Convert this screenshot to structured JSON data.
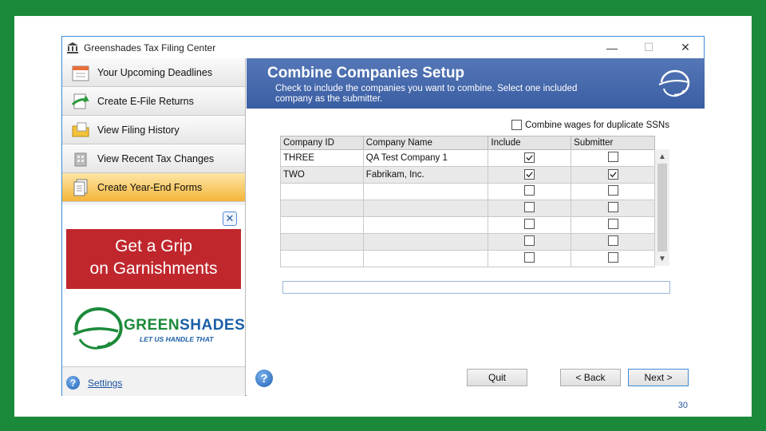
{
  "window": {
    "title": "Greenshades Tax Filing Center",
    "controls": {
      "minimize": "—",
      "maximize": "☐",
      "close": "✕"
    }
  },
  "nav": {
    "items": [
      {
        "label": "Your Upcoming Deadlines",
        "icon": "calendar-icon",
        "active": false
      },
      {
        "label": "Create E-File Returns",
        "icon": "efile-icon",
        "active": false
      },
      {
        "label": "View Filing History",
        "icon": "folder-icon",
        "active": false
      },
      {
        "label": "View Recent Tax Changes",
        "icon": "building-icon",
        "active": false
      },
      {
        "label": "Create Year-End Forms",
        "icon": "forms-icon",
        "active": true
      }
    ]
  },
  "ad": {
    "close_icon": "close-icon",
    "banner_line1": "Get a Grip",
    "banner_line2": "on Garnishments",
    "brand_part1": "GREEN",
    "brand_part2": "SHADES",
    "tagline": "LET US HANDLE THAT"
  },
  "settings": {
    "label": "Settings"
  },
  "header": {
    "title": "Combine Companies Setup",
    "subtitle": "Check to include the companies you want to combine.  Select one included company as the submitter."
  },
  "combine_wages": {
    "label": "Combine wages for duplicate SSNs",
    "checked": false
  },
  "grid": {
    "columns": [
      "Company ID",
      "Company Name",
      "Include",
      "Submitter"
    ],
    "rows": [
      {
        "company_id": "THREE",
        "company_name": "QA Test Company 1",
        "include": true,
        "submitter": false
      },
      {
        "company_id": "TWO",
        "company_name": "Fabrikam, Inc.",
        "include": true,
        "submitter": true
      },
      {
        "company_id": "",
        "company_name": "",
        "include": false,
        "submitter": false
      },
      {
        "company_id": "",
        "company_name": "",
        "include": false,
        "submitter": false
      },
      {
        "company_id": "",
        "company_name": "",
        "include": false,
        "submitter": false
      },
      {
        "company_id": "",
        "company_name": "",
        "include": false,
        "submitter": false
      },
      {
        "company_id": "",
        "company_name": "",
        "include": false,
        "submitter": false
      }
    ]
  },
  "buttons": {
    "quit": "Quit",
    "back": "< Back",
    "next": "Next >"
  },
  "slide_number": "30",
  "colors": {
    "frame": "#1a8a3a",
    "header": "#4467ac",
    "active_nav": "#f5b53a",
    "ad_red": "#c0272d"
  }
}
